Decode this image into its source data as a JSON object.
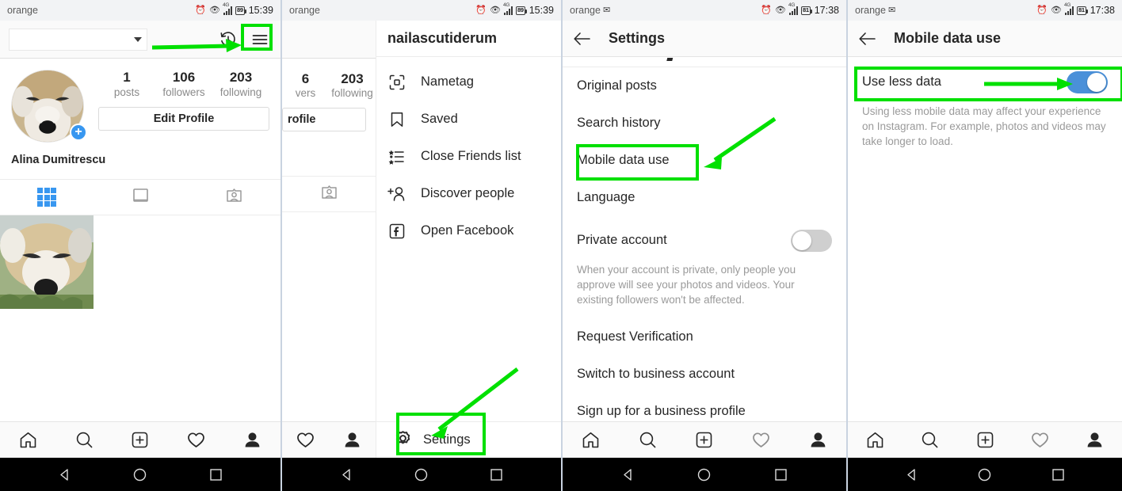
{
  "accent": {
    "highlight_green": "#00e000",
    "instagram_blue": "#3897f0",
    "toggle_blue": "#4a90d9"
  },
  "status_bars": [
    {
      "carrier": "orange",
      "mail_icon": "",
      "battery": "89",
      "time": "15:39",
      "network": "4G"
    },
    {
      "carrier": "orange",
      "mail_icon": "",
      "battery": "89",
      "time": "15:39",
      "network": "4G"
    },
    {
      "carrier": "orange",
      "mail_icon": "✉",
      "battery": "81",
      "time": "17:38",
      "network": "4G"
    },
    {
      "carrier": "orange",
      "mail_icon": "✉",
      "battery": "81",
      "time": "17:38",
      "network": "4G"
    }
  ],
  "panel1": {
    "account_select_value": "",
    "account_select_placeholder": "",
    "history_icon": "history-icon",
    "menu_icon": "hamburger-menu-icon",
    "avatar": "profile-avatar-shiba-dog",
    "add_story_label": "+",
    "stats": [
      {
        "number": "1",
        "label": "posts"
      },
      {
        "number": "106",
        "label": "followers"
      },
      {
        "number": "203",
        "label": "following"
      }
    ],
    "edit_profile_label": "Edit Profile",
    "full_name": "Alina Dumitrescu",
    "tabs": [
      {
        "name": "grid-tab",
        "icon": "grid-icon",
        "active": true
      },
      {
        "name": "list-tab",
        "icon": "square-list-icon",
        "active": false
      },
      {
        "name": "tagged-tab",
        "icon": "person-card-icon",
        "active": false
      }
    ],
    "post_thumbnail": "post-thumbnail-sleeping-dog"
  },
  "panel2": {
    "behind": {
      "stats": [
        {
          "number": "6",
          "label": "vers"
        },
        {
          "number": "203",
          "label": "following"
        }
      ],
      "edit_profile_label": "rofile"
    },
    "drawer_title": "nailascutiderum",
    "drawer_items": [
      {
        "icon": "nametag-icon",
        "label": "Nametag"
      },
      {
        "icon": "bookmark-icon",
        "label": "Saved"
      },
      {
        "icon": "close-friends-list-icon",
        "label": "Close Friends list"
      },
      {
        "icon": "discover-people-icon",
        "label": "Discover people"
      },
      {
        "icon": "facebook-icon",
        "label": "Open Facebook"
      }
    ],
    "settings_label": "Settings",
    "settings_icon": "gear-icon"
  },
  "panel3": {
    "title": "Settings",
    "back_icon": "back-arrow-icon",
    "items": [
      {
        "label": "Original posts",
        "type": "link"
      },
      {
        "label": "Search history",
        "type": "link"
      },
      {
        "label": "Mobile data use",
        "type": "link",
        "highlighted": true
      },
      {
        "label": "Language",
        "type": "link"
      },
      {
        "label": "Private account",
        "type": "toggle",
        "toggle_on": false
      },
      {
        "label": "Request Verification",
        "type": "link"
      },
      {
        "label": "Switch to business account",
        "type": "link"
      },
      {
        "label": "Sign up for a business profile",
        "type": "link"
      }
    ],
    "private_account_note": "When your account is private, only people you approve will see your photos and videos. Your existing followers won't be affected."
  },
  "panel4": {
    "title": "Mobile data use",
    "back_icon": "back-arrow-icon",
    "toggle_label": "Use less data",
    "toggle_on": true,
    "note": "Using less mobile data may affect your experience on Instagram. For example, photos and videos may take longer to load."
  },
  "bottom_nav": [
    {
      "name": "nav-home",
      "icon": "home-icon"
    },
    {
      "name": "nav-search",
      "icon": "search-icon"
    },
    {
      "name": "nav-add",
      "icon": "plus-square-icon"
    },
    {
      "name": "nav-activity",
      "icon": "heart-icon"
    },
    {
      "name": "nav-profile",
      "icon": "person-filled-icon"
    }
  ],
  "system_nav": [
    {
      "name": "android-back-button",
      "icon": "triangle-left-icon"
    },
    {
      "name": "android-home-button",
      "icon": "circle-icon"
    },
    {
      "name": "android-recents-button",
      "icon": "square-icon"
    }
  ]
}
